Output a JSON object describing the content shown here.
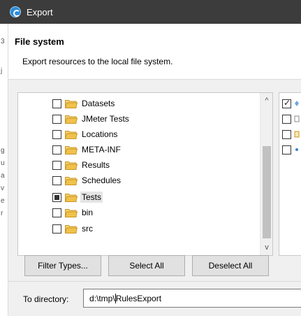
{
  "window": {
    "title": "Export"
  },
  "header": {
    "title": "File system",
    "description": "Export resources to the local file system."
  },
  "tree": {
    "items": [
      {
        "label": "Datasets",
        "state": "unchecked",
        "selected": false
      },
      {
        "label": "JMeter Tests",
        "state": "unchecked",
        "selected": false
      },
      {
        "label": "Locations",
        "state": "unchecked",
        "selected": false
      },
      {
        "label": "META-INF",
        "state": "unchecked",
        "selected": false
      },
      {
        "label": "Results",
        "state": "unchecked",
        "selected": false
      },
      {
        "label": "Schedules",
        "state": "unchecked",
        "selected": false
      },
      {
        "label": "Tests",
        "state": "partial",
        "selected": true
      },
      {
        "label": "bin",
        "state": "unchecked",
        "selected": false
      },
      {
        "label": "src",
        "state": "unchecked",
        "selected": false
      }
    ]
  },
  "right_list": {
    "items": [
      {
        "state": "checked"
      },
      {
        "state": "unchecked"
      },
      {
        "state": "unchecked"
      },
      {
        "state": "unchecked"
      }
    ]
  },
  "buttons": {
    "filter_types": "Filter Types...",
    "select_all": "Select All",
    "deselect_all": "Deselect All"
  },
  "directory": {
    "label": "To directory:",
    "value_before_caret": "d:\\tmp\\",
    "value_after_caret": "RulesExport"
  },
  "colors": {
    "title_bar": "#3c3c3c",
    "folder": "#f0c24a",
    "button_bg": "#e1e1e1"
  }
}
